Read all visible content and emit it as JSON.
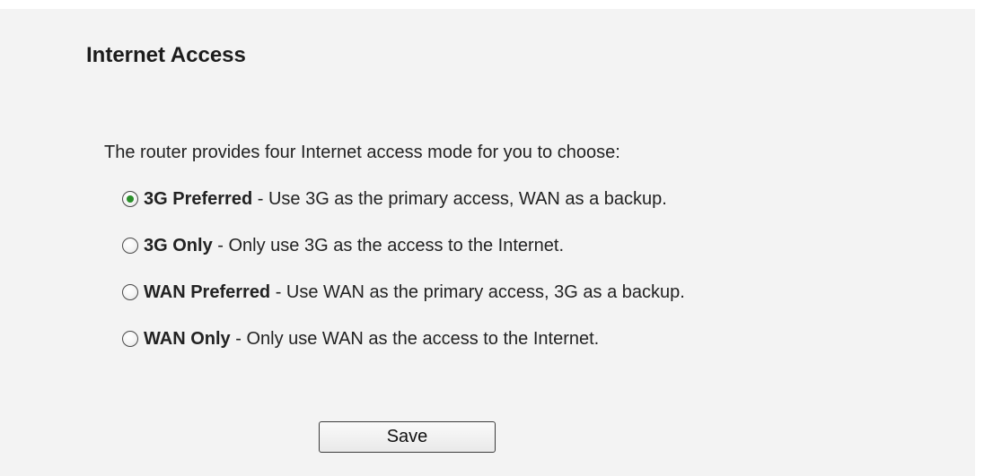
{
  "page": {
    "title": "Internet Access",
    "intro": "The router provides four Internet access mode for you to choose:"
  },
  "modes": [
    {
      "name": "3G Preferred",
      "description": " - Use 3G as the primary access, WAN as a backup.",
      "selected": true
    },
    {
      "name": "3G Only",
      "description": " - Only use 3G as the access to the Internet.",
      "selected": false
    },
    {
      "name": "WAN Preferred",
      "description": " - Use WAN as the primary access, 3G as a backup.",
      "selected": false
    },
    {
      "name": "WAN Only",
      "description": " - Only use WAN as the access to the Internet.",
      "selected": false
    }
  ],
  "actions": {
    "save_label": "Save"
  },
  "colors": {
    "panel_background": "#f3f3f3",
    "radio_selected": "#2a8f2a"
  }
}
